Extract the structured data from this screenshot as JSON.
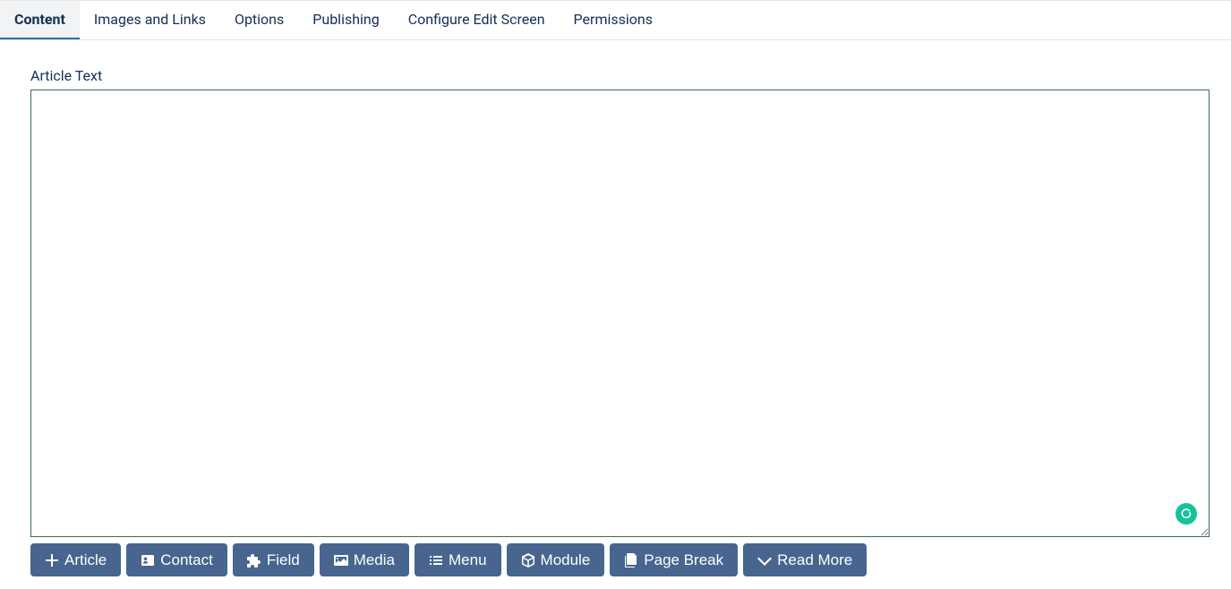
{
  "tabs": [
    {
      "label": "Content",
      "active": true
    },
    {
      "label": "Images and Links",
      "active": false
    },
    {
      "label": "Options",
      "active": false
    },
    {
      "label": "Publishing",
      "active": false
    },
    {
      "label": "Configure Edit Screen",
      "active": false
    },
    {
      "label": "Permissions",
      "active": false
    }
  ],
  "field_label": "Article Text",
  "editor_value": "",
  "buttons": {
    "article": "Article",
    "contact": "Contact",
    "field": "Field",
    "media": "Media",
    "menu": "Menu",
    "module": "Module",
    "page_break": "Page Break",
    "read_more": "Read More"
  }
}
